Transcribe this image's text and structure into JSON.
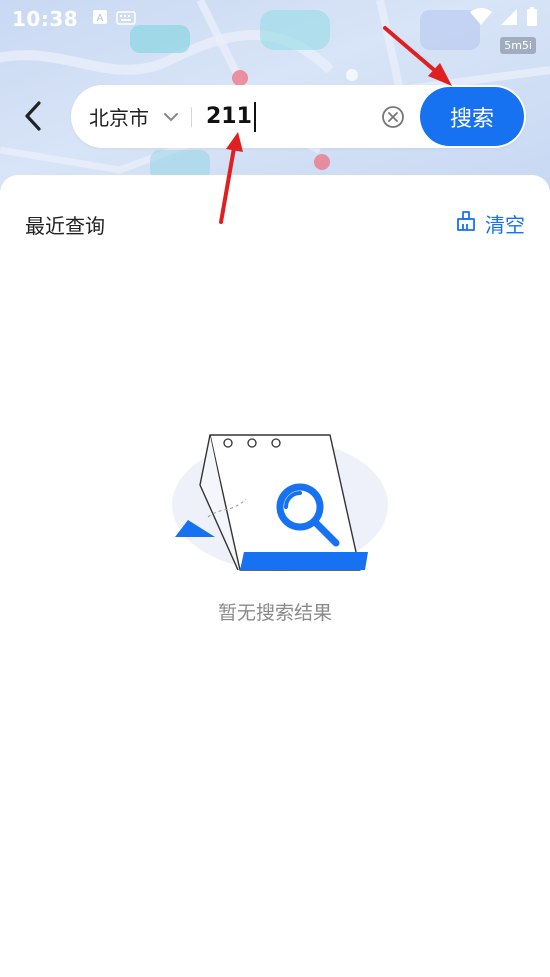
{
  "status_bar": {
    "time": "10:38",
    "badge": "5m5i",
    "icons": [
      "a-notification-icon",
      "keyboard-icon",
      "wifi-icon",
      "signal-icon",
      "battery-icon"
    ]
  },
  "search": {
    "city": "北京市",
    "query": "211",
    "button_label": "搜索"
  },
  "recent": {
    "title": "最近查询",
    "clear_label": "清空"
  },
  "empty_state": {
    "message": "暂无搜索结果"
  },
  "colors": {
    "accent": "#1672f0",
    "annotation_arrow": "#e02020"
  }
}
